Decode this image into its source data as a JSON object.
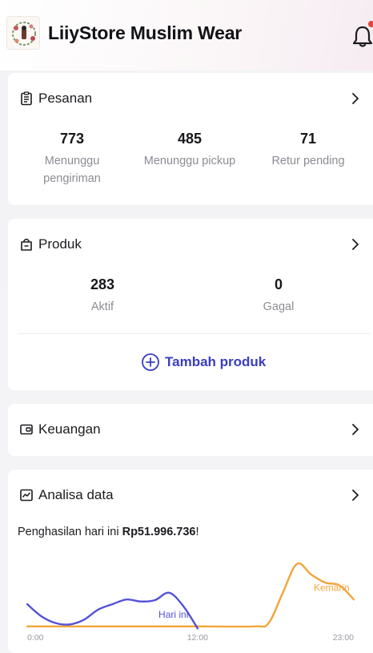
{
  "header": {
    "store_name": "LiiyStore Muslim Wear",
    "notification_icon": "bell-icon",
    "notification_dot_color": "#e8433a"
  },
  "orders": {
    "title": "Pesanan",
    "icon": "clipboard-icon",
    "stats": [
      {
        "value": "773",
        "label_line1": "Menunggu",
        "label_line2": "pengiriman"
      },
      {
        "value": "485",
        "label_line1": "Menunggu pickup",
        "label_line2": ""
      },
      {
        "value": "71",
        "label_line1": "Retur pending",
        "label_line2": ""
      }
    ]
  },
  "products": {
    "title": "Produk",
    "icon": "bag-icon",
    "stats": [
      {
        "value": "283",
        "label": "Aktif"
      },
      {
        "value": "0",
        "label": "Gagal"
      }
    ],
    "add_label": "Tambah produk",
    "accent_color": "#3a3dc4"
  },
  "finance": {
    "title": "Keuangan",
    "icon": "wallet-icon"
  },
  "analytics": {
    "title": "Analisa data",
    "icon": "chart-icon",
    "earnings_prefix": "Penghasilan hari ini",
    "earnings_value": "Rp51.996.736",
    "earnings_suffix": "!",
    "chart_data": {
      "type": "line",
      "x_ticks": [
        "0:00",
        "12:00",
        "23:00"
      ],
      "series": [
        {
          "name": "Hari ini",
          "color": "#5552d6",
          "hours": [
            0,
            1,
            2,
            3,
            4,
            5,
            6,
            7,
            8,
            9,
            10,
            11,
            12
          ],
          "values": [
            0.38,
            0.2,
            0.1,
            0.08,
            0.15,
            0.3,
            0.38,
            0.45,
            0.42,
            0.44,
            0.55,
            0.35,
            0.02
          ]
        },
        {
          "name": "Kemarin",
          "color": "#f2a53a",
          "hours": [
            0,
            4,
            8,
            12,
            16,
            17,
            18,
            19,
            20,
            21,
            22,
            23
          ],
          "values": [
            0.05,
            0.05,
            0.05,
            0.05,
            0.05,
            0.1,
            0.55,
            0.98,
            0.82,
            0.7,
            0.66,
            0.45
          ]
        }
      ]
    }
  }
}
